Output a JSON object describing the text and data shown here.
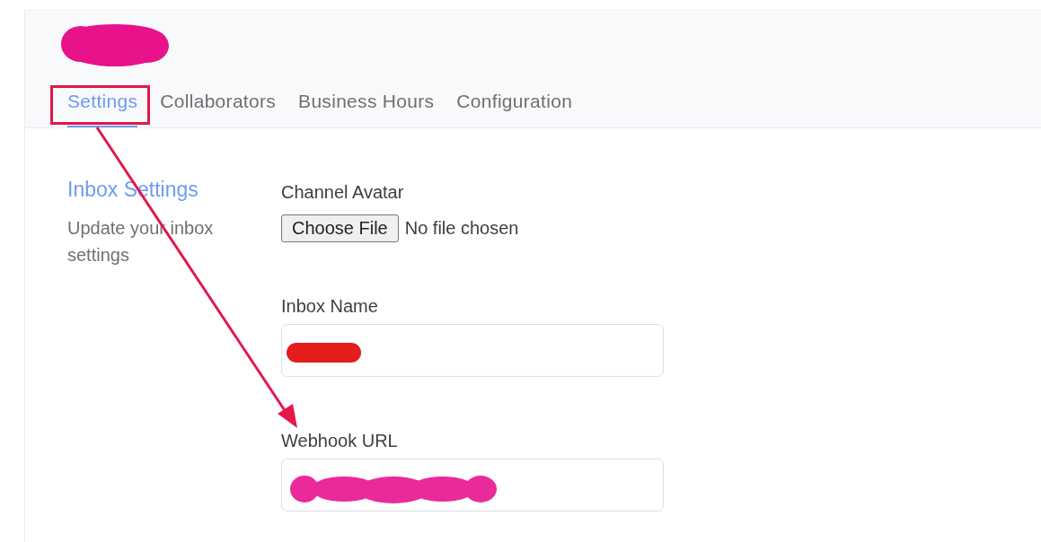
{
  "header": {
    "title": {
      "redaction": {
        "kind": "scribble"
      }
    }
  },
  "tabs": [
    {
      "label": "Settings",
      "selected": true,
      "highlighted": true
    },
    {
      "label": "Collaborators",
      "selected": false,
      "highlighted": false
    },
    {
      "label": "Business Hours",
      "selected": false,
      "highlighted": false
    },
    {
      "label": "Configuration",
      "selected": false,
      "highlighted": false
    }
  ],
  "section": {
    "title": "Inbox Settings",
    "description": "Update your inbox settings"
  },
  "fields": [
    {
      "kind": "file",
      "label": "Channel Avatar",
      "button": "Choose File",
      "status": "No file chosen"
    },
    {
      "kind": "text",
      "label": "Inbox Name",
      "redaction": {
        "kind": "bar"
      }
    },
    {
      "kind": "text",
      "label": "Webhook URL",
      "redaction": {
        "kind": "scribble"
      }
    }
  ],
  "annotations": [
    {
      "kind": "arrow"
    }
  ]
}
